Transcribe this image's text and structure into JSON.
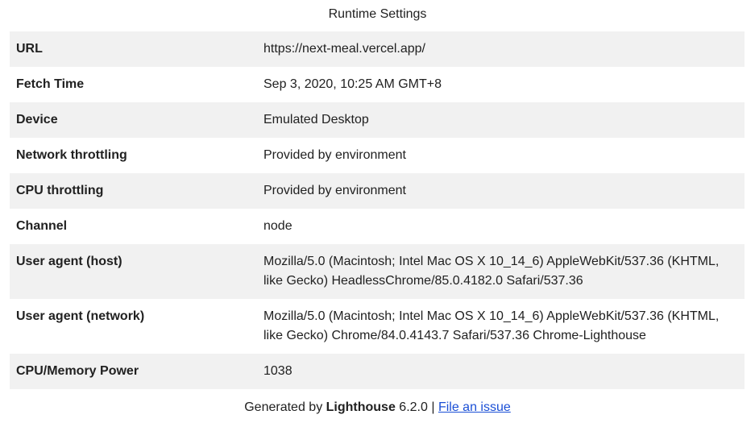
{
  "title": "Runtime Settings",
  "rows": [
    {
      "label": "URL",
      "value": "https://next-meal.vercel.app/"
    },
    {
      "label": "Fetch Time",
      "value": "Sep 3, 2020, 10:25 AM GMT+8"
    },
    {
      "label": "Device",
      "value": "Emulated Desktop"
    },
    {
      "label": "Network throttling",
      "value": "Provided by environment"
    },
    {
      "label": "CPU throttling",
      "value": "Provided by environment"
    },
    {
      "label": "Channel",
      "value": "node"
    },
    {
      "label": "User agent (host)",
      "value": "Mozilla/5.0 (Macintosh; Intel Mac OS X 10_14_6) AppleWebKit/537.36 (KHTML, like Gecko) HeadlessChrome/85.0.4182.0 Safari/537.36"
    },
    {
      "label": "User agent (network)",
      "value": "Mozilla/5.0 (Macintosh; Intel Mac OS X 10_14_6) AppleWebKit/537.36 (KHTML, like Gecko) Chrome/84.0.4143.7 Safari/537.36 Chrome-Lighthouse"
    },
    {
      "label": "CPU/Memory Power",
      "value": "1038"
    }
  ],
  "footer": {
    "prefix": "Generated by ",
    "product": "Lighthouse",
    "version": " 6.2.0 | ",
    "link": "File an issue"
  }
}
